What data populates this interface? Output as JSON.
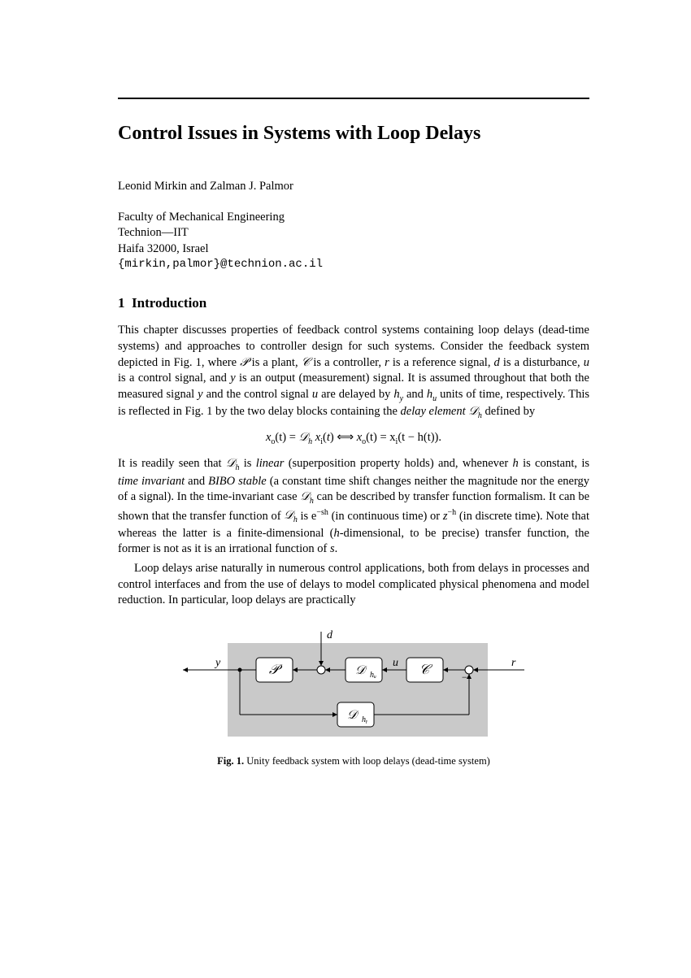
{
  "title": "Control Issues in Systems with Loop Delays",
  "authors": "Leonid Mirkin and Zalman J. Palmor",
  "affiliation": {
    "line1": "Faculty of Mechanical Engineering",
    "line2": "Technion—IIT",
    "line3": "Haifa 32000, Israel",
    "email": "{mirkin,palmor}@technion.ac.il"
  },
  "section_number": "1",
  "section_title": "Introduction",
  "paragraphs": {
    "p1a": "This chapter discusses properties of feedback control systems containing loop delays (dead-time systems) and approaches to controller design for such systems. Consider the feedback system depicted in Fig. 1, where ",
    "p1b": " is a plant, ",
    "p1c": " is a controller, ",
    "p1d": " is a reference signal, ",
    "p1e": " is a disturbance, ",
    "p1f": " is a control signal, and ",
    "p1g": " is an output (measurement) signal. It is assumed throughout that both the measured signal ",
    "p1h": " and the control signal ",
    "p1i": " are delayed by ",
    "p1j": " and ",
    "p1k": " units of time, respectively. This is reflected in Fig. 1 by the two delay blocks containing the ",
    "p1l": "delay element",
    "p1m": " defined by",
    "p2a": "It is readily seen that ",
    "p2b": " is ",
    "p2c": "linear",
    "p2d": " (superposition property holds) and, whenever ",
    "p2e": " is constant, is ",
    "p2f": "time invariant",
    "p2g": " and ",
    "p2h": "BIBO stable",
    "p2i": " (a constant time shift changes neither the magnitude nor the energy of a signal). In the time-invariant case ",
    "p2j": " can be described by transfer function formalism. It can be shown that the transfer function of ",
    "p2k": " is e",
    "p2l": " (in continuous time) or ",
    "p2m": " (in discrete time). Note that whereas the latter is a finite-dimensional (",
    "p2n": "-dimensional, to be precise) transfer function, the former is not as it is an irrational function of ",
    "p2o": ".",
    "p3": "Loop delays arise naturally in numerous control applications, both from delays in processes and control interfaces and from the use of delays to model complicated physical phenomena and model reduction. In particular, loop delays are practically"
  },
  "equation": {
    "lhs1": "x",
    "sub_o": "o",
    "t": "(t) = ",
    "Dh": "𝒟",
    "sub_h": "h",
    "sp": " x",
    "sub_i": "i",
    "iff": "  ⟺  ",
    "rhs": "(t) = x",
    "tail": "(t − h(t))."
  },
  "symbols": {
    "P": "𝒫",
    "C": "𝒞",
    "D": "𝒟",
    "r": "r",
    "d": "d",
    "u": "u",
    "y": "y",
    "hy": "h",
    "hu": "h",
    "h": "h",
    "s": "s",
    "z": "z",
    "neg_sh": "−sh",
    "neg_h": "−h"
  },
  "figure": {
    "caption_label": "Fig. 1.",
    "caption_text": " Unity feedback system with loop delays (dead-time system)",
    "labels": {
      "y": "y",
      "d": "d",
      "u": "u",
      "r": "r",
      "P": "𝒫",
      "C": "𝒞",
      "Dhu": "𝒟",
      "Dhy": "𝒟",
      "hu_sub": "hᵤ",
      "hy_sub": "hᵧ"
    }
  }
}
